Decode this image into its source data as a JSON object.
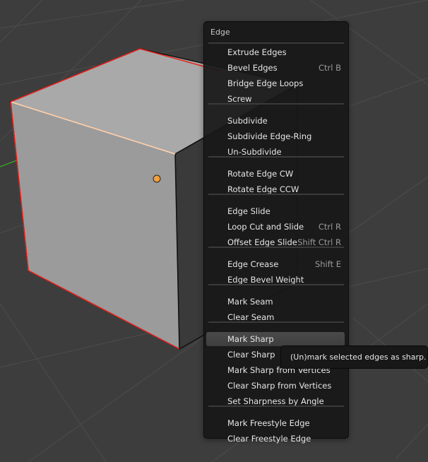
{
  "menu": {
    "title": "Edge",
    "groups": [
      [
        {
          "label": "Extrude Edges",
          "key": "E"
        },
        {
          "label": "Bevel Edges",
          "key": "B",
          "shortcut": "Ctrl B"
        },
        {
          "label": "Bridge Edge Loops",
          "key": "L"
        },
        {
          "label": "Screw",
          "key": "S"
        }
      ],
      [
        {
          "label": "Subdivide",
          "key": "d"
        },
        {
          "label": "Subdivide Edge-Ring",
          "key": "R"
        },
        {
          "label": "Un-Subdivide",
          "key": "U"
        }
      ],
      [
        {
          "label": "Rotate Edge CW",
          "key": "W"
        },
        {
          "label": "Rotate Edge CCW",
          "key": "o"
        }
      ],
      [
        {
          "label": "Edge Slide",
          "key": ""
        },
        {
          "label": "Loop Cut and Slide",
          "key": "a",
          "shortcut": "Ctrl R"
        },
        {
          "label": "Offset Edge Slide",
          "key": "O",
          "shortcut": "Shift Ctrl R"
        }
      ],
      [
        {
          "label": "Edge Crease",
          "key": "",
          "shortcut": "Shift E"
        },
        {
          "label": "Edge Bevel Weight",
          "key": "W"
        }
      ],
      [
        {
          "label": "Mark Seam",
          "key": "S"
        },
        {
          "label": "Clear Seam",
          "key": ""
        }
      ],
      [
        {
          "label": "Mark Sharp",
          "key": "k",
          "active": true
        },
        {
          "label": "Clear Sharp",
          "key": "h"
        },
        {
          "label": "Mark Sharp from Vertices",
          "key": "f"
        },
        {
          "label": "Clear Sharp from Vertices",
          "key": "V"
        },
        {
          "label": "Set Sharpness by Angle",
          "key": "p"
        }
      ],
      [
        {
          "label": "Mark Freestyle Edge",
          "key": "y"
        },
        {
          "label": "Clear Freestyle Edge",
          "key": ""
        }
      ]
    ]
  },
  "tooltip": {
    "text": "(Un)mark selected edges as sharp."
  },
  "colors": {
    "selected_edge": "#e8201a",
    "origin": "#f0a040",
    "axis_y": "#3c9a2c"
  }
}
